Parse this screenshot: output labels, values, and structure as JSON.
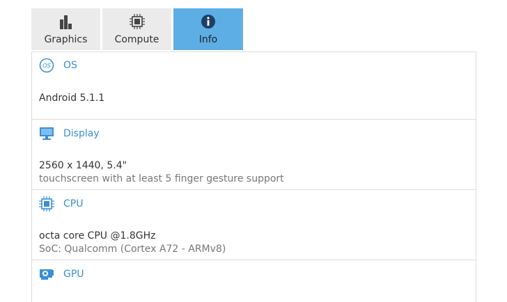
{
  "tabs": [
    {
      "label": "Graphics",
      "icon": "bar-chart-icon"
    },
    {
      "label": "Compute",
      "icon": "chip-icon"
    },
    {
      "label": "Info",
      "icon": "info-icon"
    }
  ],
  "sections": {
    "os": {
      "title": "OS",
      "value": "Android 5.1.1"
    },
    "display": {
      "title": "Display",
      "value": "2560 x 1440, 5.4\"",
      "detail": "touchscreen with at least 5 finger gesture support"
    },
    "cpu": {
      "title": "CPU",
      "value": "octa core CPU @1.8GHz",
      "detail": "SoC: Qualcomm (Cortex A72 - ARMv8)"
    },
    "gpu": {
      "title": "GPU"
    }
  },
  "colors": {
    "accent": "#3a8fd6",
    "active_tab": "#5eaee6",
    "tab_bg": "#ebebeb"
  }
}
